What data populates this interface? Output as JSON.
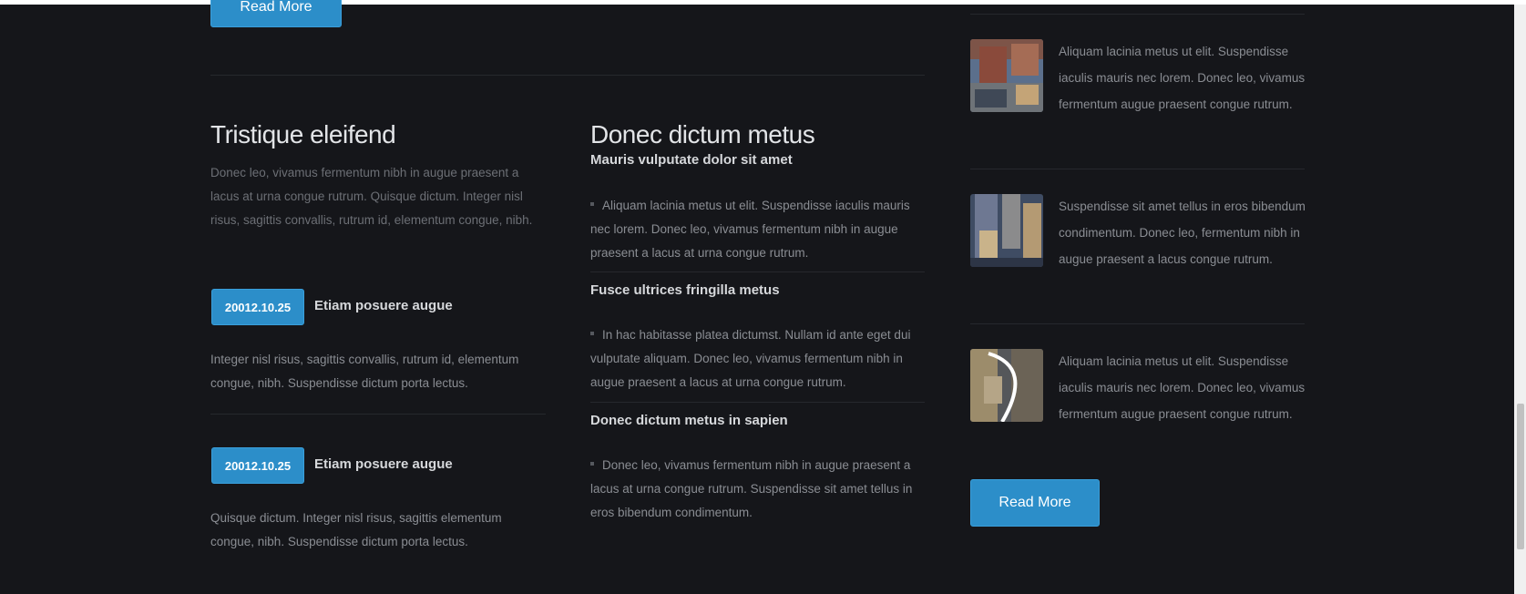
{
  "top_read_more": "Read More",
  "col1": {
    "heading": "Tristique eleifend",
    "intro": "Donec leo, vivamus fermentum nibh in augue praesent a lacus at urna congue rutrum. Quisque dictum. Integer nisl risus, sagittis convallis, rutrum id, elementum congue, nibh.",
    "news": [
      {
        "date": "20012.10.25",
        "title": "Etiam posuere augue",
        "text": "Integer nisl risus, sagittis convallis, rutrum id, elementum congue, nibh. Suspendisse dictum porta lectus."
      },
      {
        "date": "20012.10.25",
        "title": "Etiam posuere augue",
        "text": "Quisque dictum. Integer nisl risus, sagittis elementum congue, nibh. Suspendisse dictum porta lectus."
      }
    ]
  },
  "col2": {
    "heading": "Donec dictum metus",
    "items": [
      {
        "title": "Mauris vulputate dolor sit amet",
        "text": "Aliquam lacinia metus ut elit. Suspendisse iaculis mauris nec lorem. Donec leo, vivamus fermentum nibh in augue praesent a lacus at urna congue rutrum."
      },
      {
        "title": "Fusce ultrices fringilla metus",
        "text": "In hac habitasse platea dictumst. Nullam id ante eget dui vulputate aliquam. Donec leo, vivamus fermentum nibh in augue praesent a lacus at urna congue rutrum."
      },
      {
        "title": "Donec dictum metus in sapien",
        "text": "Donec leo, vivamus fermentum nibh in augue praesent a lacus at urna congue rutrum. Suspendisse sit amet tellus in eros bibendum condimentum."
      }
    ]
  },
  "col3": {
    "items": [
      {
        "text": "Aliquam lacinia metus ut elit. Suspendisse iaculis mauris nec lorem. Donec leo, vivamus fermentum augue praesent congue rutrum."
      },
      {
        "text": "Suspendisse sit amet tellus in eros bibendum condimentum. Donec leo, fermentum nibh in augue praesent a lacus congue rutrum."
      },
      {
        "text": "Aliquam lacinia metus ut elit. Suspendisse iaculis mauris nec lorem. Donec leo, vivamus fermentum augue praesent congue rutrum."
      }
    ],
    "read_more": "Read More"
  },
  "colors": {
    "accent": "#2c8ec9",
    "background": "#15161a"
  }
}
